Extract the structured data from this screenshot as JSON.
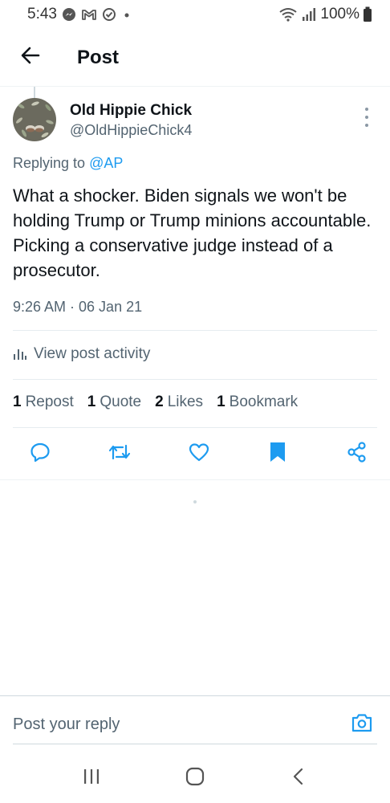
{
  "status_bar": {
    "time": "5:43",
    "battery": "100%",
    "icons": [
      "messenger-icon",
      "gmail-icon",
      "check-circle-icon",
      "dot-icon",
      "wifi-icon",
      "signal-icon",
      "battery-icon"
    ]
  },
  "header": {
    "title": "Post",
    "back_icon": "arrow-left-icon"
  },
  "post": {
    "author": {
      "display_name": "Old Hippie Chick",
      "handle": "@OldHippieChick4"
    },
    "replying_prefix": "Replying to",
    "replying_to": "@AP",
    "text": "What a shocker. Biden signals we won't be holding Trump or Trump minions accountable. Picking a conservative judge instead of a prosecutor.",
    "timestamp": "9:26 AM · 06 Jan 21",
    "activity_label": "View post activity",
    "stats": {
      "reposts_count": "1",
      "reposts_label": "Repost",
      "quotes_count": "1",
      "quotes_label": "Quote",
      "likes_count": "2",
      "likes_label": "Likes",
      "bookmarks_count": "1",
      "bookmarks_label": "Bookmark"
    },
    "actions": [
      "reply-icon",
      "repost-icon",
      "like-icon",
      "bookmark-icon",
      "share-icon"
    ]
  },
  "reply_bar": {
    "placeholder": "Post your reply"
  },
  "colors": {
    "accent": "#1d9bf0",
    "text_primary": "#0f1419",
    "text_secondary": "#536471"
  }
}
